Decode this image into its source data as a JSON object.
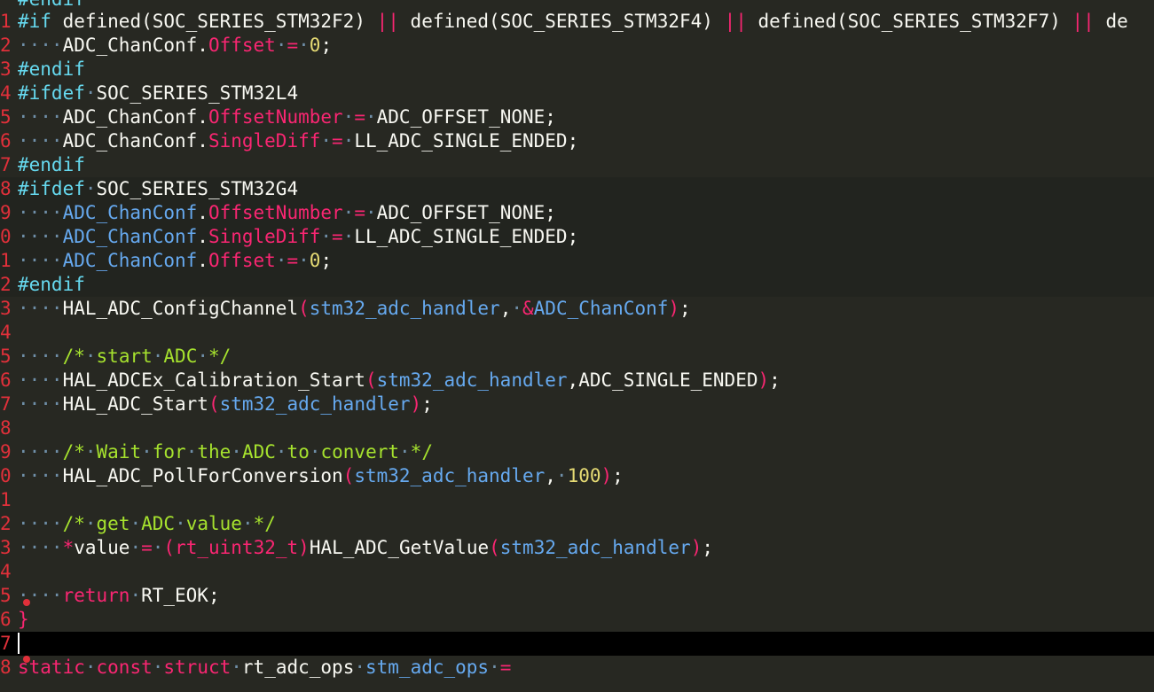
{
  "gutter_numbers": [
    "",
    "1",
    "2",
    "3",
    "4",
    "5",
    "6",
    "7",
    "8",
    "9",
    "0",
    "1",
    "2",
    "3",
    "4",
    "5",
    "6",
    "7",
    "8",
    "9",
    "0",
    "1",
    "2",
    "3",
    "4",
    "5",
    "6",
    "7",
    "8"
  ],
  "lines": [
    "#endif",
    "#if defined(SOC_SERIES_STM32F2) || defined(SOC_SERIES_STM32F4) || defined(SOC_SERIES_STM32F7) || de",
    "    ADC_ChanConf.Offset = 0;",
    "#endif",
    "#ifdef SOC_SERIES_STM32L4",
    "    ADC_ChanConf.OffsetNumber = ADC_OFFSET_NONE;",
    "    ADC_ChanConf.SingleDiff = LL_ADC_SINGLE_ENDED;",
    "#endif",
    "#ifdef SOC_SERIES_STM32G4",
    "    ADC_ChanConf.OffsetNumber = ADC_OFFSET_NONE;",
    "    ADC_ChanConf.SingleDiff = LL_ADC_SINGLE_ENDED;",
    "    ADC_ChanConf.Offset = 0;",
    "#endif",
    "    HAL_ADC_ConfigChannel(stm32_adc_handler, &ADC_ChanConf);",
    "",
    "    /* start ADC */",
    "    HAL_ADCEx_Calibration_Start(stm32_adc_handler,ADC_SINGLE_ENDED);",
    "    HAL_ADC_Start(stm32_adc_handler);",
    "",
    "    /* Wait for the ADC to convert */",
    "    HAL_ADC_PollForConversion(stm32_adc_handler, 100);",
    "",
    "    /* get ADC value */",
    "    *value = (rt_uint32_t)HAL_ADC_GetValue(stm32_adc_handler);",
    "",
    "    return RT_EOK;",
    "}",
    "",
    "static const struct rt_adc_ops stm_adc_ops ="
  ],
  "colors": {
    "background": "#272822",
    "current_line": "#000000",
    "gutter_number": "#e0303a",
    "keyword": "#f92672",
    "comment": "#a6e22e",
    "number": "#e6db74",
    "variable": "#66a9ef"
  }
}
